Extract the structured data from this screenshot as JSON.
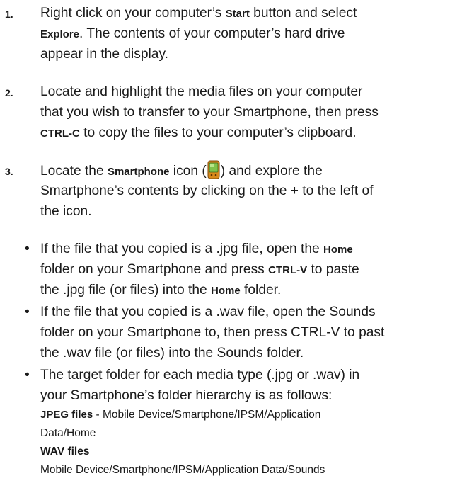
{
  "steps": [
    {
      "number": "1.",
      "line1_a": "Right click on your computer’s ",
      "line1_b": "Start",
      "line1_c": " button and select",
      "line2_a": "Explore",
      "line2_b": ". The contents of your computer’s hard drive",
      "line3": "appear in the display."
    },
    {
      "number": "2.",
      "line1": "Locate and highlight the media files on your computer",
      "line2": "that you wish to transfer to your Smartphone, then press",
      "line3_a": "CTRL-C",
      "line3_b": " to copy the files to your computer’s clipboard."
    },
    {
      "number": "3.",
      "line1_a": "Locate the ",
      "line1_b": "Smartphone",
      "line1_c": " icon (",
      "line1_d": ") and explore the",
      "line2": "Smartphone’s contents by clicking on the + to the left of",
      "line3": "the icon.",
      "icon": "smartphone-icon"
    }
  ],
  "bullets": [
    {
      "symbol": "•",
      "line1_a": "If the file that you copied is a .jpg file, open the ",
      "line1_b": "Home",
      "line2_a": "folder on your Smartphone and press ",
      "line2_b": "CTRL-V",
      "line2_c": " to paste",
      "line3_a": "the .jpg file (or files) into the ",
      "line3_b": "Home",
      "line3_c": " folder."
    },
    {
      "symbol": "•",
      "line1": "If the file that you copied is a .wav file, open the Sounds",
      "line2": "folder on your Smartphone to, then press CTRL-V to past",
      "line3": "the .wav file (or files) into the Sounds folder."
    },
    {
      "symbol": "•",
      "line1": "The target folder for each media type (.jpg or .wav) in",
      "line2": "your Smartphone’s folder hierarchy is as follows:",
      "jpeg_label": "JPEG files",
      "jpeg_sep": " - ",
      "jpeg_path1": "Mobile Device/Smartphone/IPSM/Application",
      "jpeg_path2": "Data/Home",
      "wav_label": "WAV files",
      "wav_path": "Mobile Device/Smartphone/IPSM/Application Data/Sounds"
    }
  ]
}
